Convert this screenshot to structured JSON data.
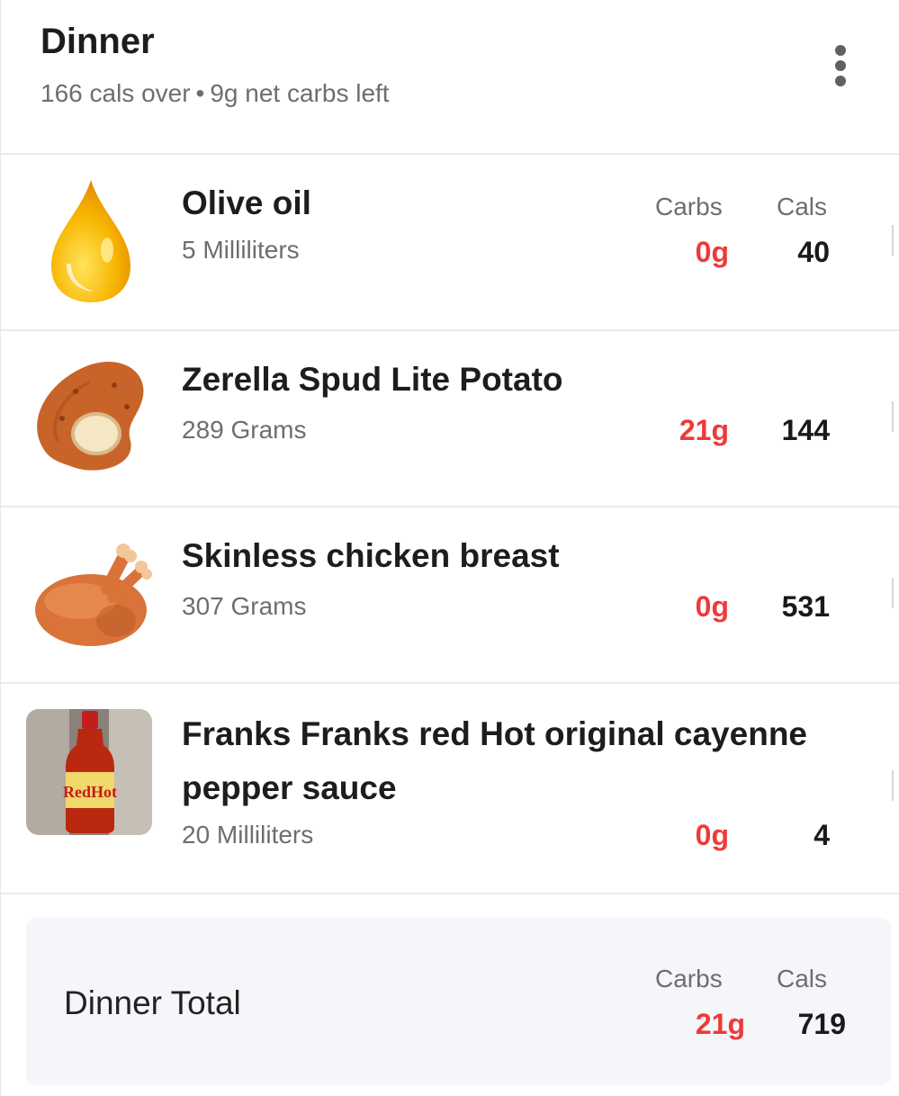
{
  "header": {
    "title": "Dinner",
    "cals_status": "166 cals over",
    "separator": "•",
    "carbs_status": "9g net carbs left",
    "menu_icon": "more-vertical-icon"
  },
  "columns": {
    "carbs": "Carbs",
    "cals": "Cals"
  },
  "items": [
    {
      "name": "Olive oil",
      "quantity": "5 Milliliters",
      "carbs": "0g",
      "cals": "40",
      "icon": "oil-drop-icon"
    },
    {
      "name": "Zerella Spud Lite Potato",
      "quantity": "289 Grams",
      "carbs": "21g",
      "cals": "144",
      "icon": "potato-icon"
    },
    {
      "name": "Skinless chicken breast",
      "quantity": "307 Grams",
      "carbs": "0g",
      "cals": "531",
      "icon": "roast-chicken-icon"
    },
    {
      "name": "Franks Franks red Hot original cayenne pepper sauce",
      "quantity": "20 Milliliters",
      "carbs": "0g",
      "cals": "4",
      "icon": "hot-sauce-bottle-photo",
      "image_text": "RedHot"
    }
  ],
  "total": {
    "label": "Dinner Total",
    "carbs": "21g",
    "cals": "719"
  },
  "colors": {
    "carbs": "#ee3a3a",
    "text": "#1d1d1d",
    "muted": "#6e6e6e",
    "total_bg": "#f5f6fa"
  }
}
